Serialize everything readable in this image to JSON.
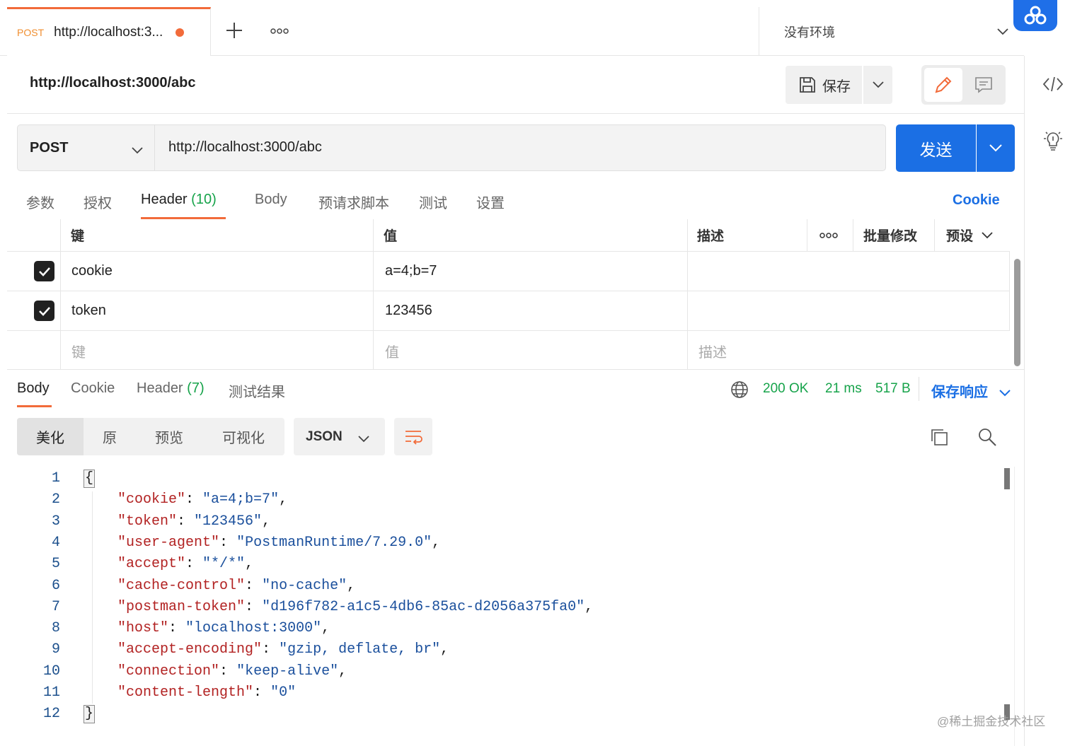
{
  "tabs": [
    {
      "method": "POST",
      "title": "http://localhost:3..."
    }
  ],
  "environment": {
    "label": "没有环境"
  },
  "request": {
    "title": "http://localhost:3000/abc",
    "save_label": "保存",
    "method": "POST",
    "url": "http://localhost:3000/abc",
    "send_label": "发送"
  },
  "request_tabs": [
    {
      "label": "参数"
    },
    {
      "label": "授权"
    },
    {
      "label": "Header",
      "count": "(10)"
    },
    {
      "label": "Body"
    },
    {
      "label": "预请求脚本"
    },
    {
      "label": "测试"
    },
    {
      "label": "设置"
    }
  ],
  "cookie_link": "Cookie",
  "headers_table": {
    "columns": {
      "key": "键",
      "value": "值",
      "description": "描述",
      "more": "ooo",
      "bulk_edit": "批量修改",
      "presets": "预设"
    },
    "rows": [
      {
        "checked": true,
        "key": "cookie",
        "value": "a=4;b=7",
        "description": ""
      },
      {
        "checked": true,
        "key": "token",
        "value": "123456",
        "description": ""
      }
    ],
    "placeholder": {
      "key": "键",
      "value": "值",
      "description": "描述"
    }
  },
  "response_tabs": [
    {
      "label": "Body"
    },
    {
      "label": "Cookie"
    },
    {
      "label": "Header",
      "count": "(7)"
    },
    {
      "label": "测试结果"
    }
  ],
  "response_status": {
    "code": "200 OK",
    "time": "21 ms",
    "size": "517 B",
    "save_label": "保存响应"
  },
  "view_modes": [
    "美化",
    "原",
    "预览",
    "可视化"
  ],
  "format": "JSON",
  "code_lines": [
    {
      "n": "1",
      "parts": [
        [
          "p",
          "{"
        ]
      ]
    },
    {
      "n": "2",
      "parts": [
        [
          "p",
          "    "
        ],
        [
          "k",
          "\"cookie\""
        ],
        [
          "p",
          ": "
        ],
        [
          "s",
          "\"a=4;b=7\""
        ],
        [
          "p",
          ","
        ]
      ]
    },
    {
      "n": "3",
      "parts": [
        [
          "p",
          "    "
        ],
        [
          "k",
          "\"token\""
        ],
        [
          "p",
          ": "
        ],
        [
          "s",
          "\"123456\""
        ],
        [
          "p",
          ","
        ]
      ]
    },
    {
      "n": "4",
      "parts": [
        [
          "p",
          "    "
        ],
        [
          "k",
          "\"user-agent\""
        ],
        [
          "p",
          ": "
        ],
        [
          "s",
          "\"PostmanRuntime/7.29.0\""
        ],
        [
          "p",
          ","
        ]
      ]
    },
    {
      "n": "5",
      "parts": [
        [
          "p",
          "    "
        ],
        [
          "k",
          "\"accept\""
        ],
        [
          "p",
          ": "
        ],
        [
          "s",
          "\"*/*\""
        ],
        [
          "p",
          ","
        ]
      ]
    },
    {
      "n": "6",
      "parts": [
        [
          "p",
          "    "
        ],
        [
          "k",
          "\"cache-control\""
        ],
        [
          "p",
          ": "
        ],
        [
          "s",
          "\"no-cache\""
        ],
        [
          "p",
          ","
        ]
      ]
    },
    {
      "n": "7",
      "parts": [
        [
          "p",
          "    "
        ],
        [
          "k",
          "\"postman-token\""
        ],
        [
          "p",
          ": "
        ],
        [
          "s",
          "\"d196f782-a1c5-4db6-85ac-d2056a375fa0\""
        ],
        [
          "p",
          ","
        ]
      ]
    },
    {
      "n": "8",
      "parts": [
        [
          "p",
          "    "
        ],
        [
          "k",
          "\"host\""
        ],
        [
          "p",
          ": "
        ],
        [
          "s",
          "\"localhost:3000\""
        ],
        [
          "p",
          ","
        ]
      ]
    },
    {
      "n": "9",
      "parts": [
        [
          "p",
          "    "
        ],
        [
          "k",
          "\"accept-encoding\""
        ],
        [
          "p",
          ": "
        ],
        [
          "s",
          "\"gzip, deflate, br\""
        ],
        [
          "p",
          ","
        ]
      ]
    },
    {
      "n": "10",
      "parts": [
        [
          "p",
          "    "
        ],
        [
          "k",
          "\"connection\""
        ],
        [
          "p",
          ": "
        ],
        [
          "s",
          "\"keep-alive\""
        ],
        [
          "p",
          ","
        ]
      ]
    },
    {
      "n": "11",
      "parts": [
        [
          "p",
          "    "
        ],
        [
          "k",
          "\"content-length\""
        ],
        [
          "p",
          ": "
        ],
        [
          "s",
          "\"0\""
        ]
      ]
    },
    {
      "n": "12",
      "parts": [
        [
          "p",
          "}"
        ]
      ]
    }
  ],
  "watermark": "@稀土掘金技术社区",
  "colors": {
    "accent_orange": "#f26b3a",
    "primary_blue": "#1b6fe4",
    "status_green": "#16a34a",
    "json_key": "#b22222",
    "json_string": "#1a4f9c"
  },
  "icons": [
    "plus-icon",
    "more-icon",
    "chevron-down-icon",
    "cloud-icon",
    "save-icon",
    "pencil-icon",
    "comment-icon",
    "code-icon",
    "lightbulb-icon",
    "checkbox-icon",
    "globe-icon",
    "wrap-icon",
    "copy-icon",
    "search-icon"
  ]
}
